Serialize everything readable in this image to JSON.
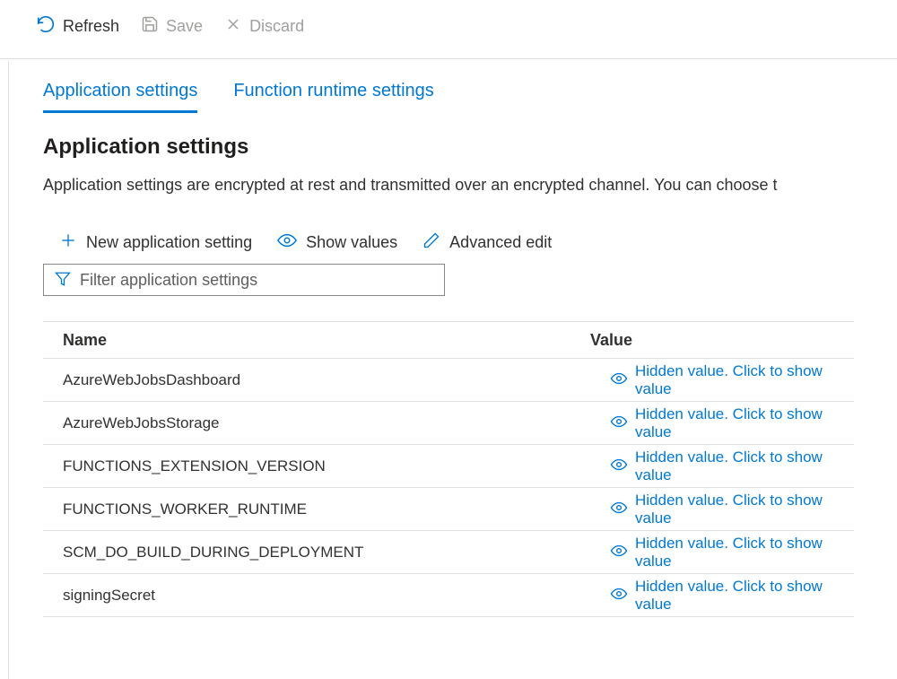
{
  "toolbar": {
    "refresh": "Refresh",
    "save": "Save",
    "discard": "Discard"
  },
  "tabs": {
    "app_settings": "Application settings",
    "runtime_settings": "Function runtime settings"
  },
  "heading": "Application settings",
  "description": "Application settings are encrypted at rest and transmitted over an encrypted channel. You can choose t",
  "actions": {
    "new_setting": "New application setting",
    "show_values": "Show values",
    "advanced_edit": "Advanced edit"
  },
  "filter": {
    "placeholder": "Filter application settings"
  },
  "table": {
    "headers": {
      "name": "Name",
      "value": "Value"
    },
    "hidden_text": "Hidden value. Click to show value",
    "rows": [
      {
        "name": "AzureWebJobsDashboard"
      },
      {
        "name": "AzureWebJobsStorage"
      },
      {
        "name": "FUNCTIONS_EXTENSION_VERSION"
      },
      {
        "name": "FUNCTIONS_WORKER_RUNTIME"
      },
      {
        "name": "SCM_DO_BUILD_DURING_DEPLOYMENT"
      },
      {
        "name": "signingSecret"
      }
    ]
  }
}
